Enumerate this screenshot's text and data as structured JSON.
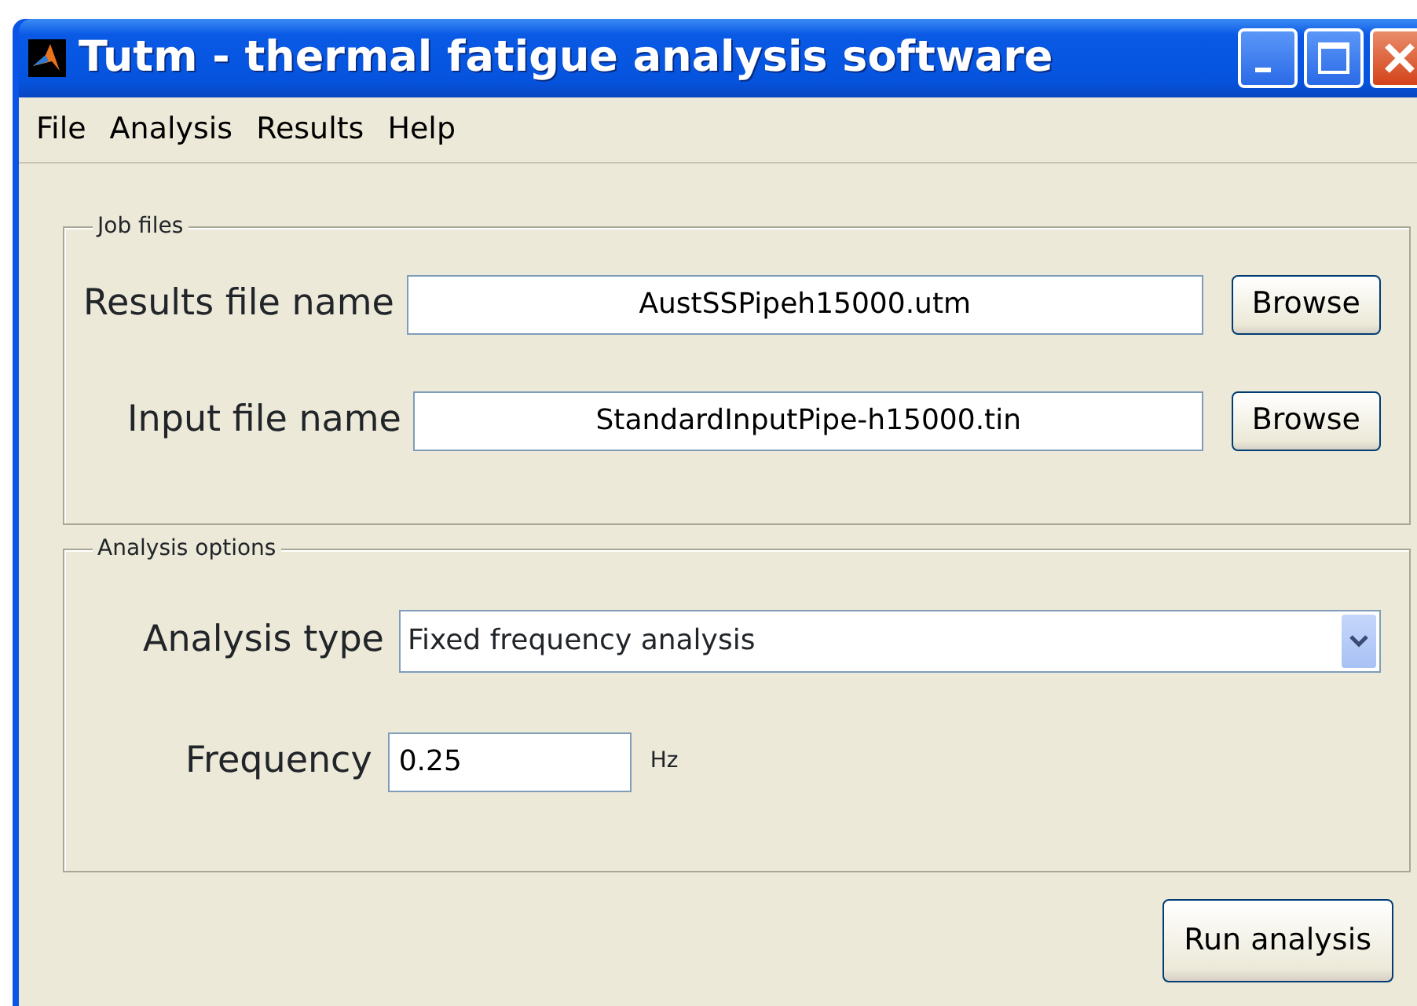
{
  "window": {
    "title": "Tutm - thermal fatigue analysis software"
  },
  "menu": [
    "File",
    "Analysis",
    "Results",
    "Help"
  ],
  "job_files": {
    "title": "Job files",
    "rows": [
      {
        "label": "Results file name",
        "value": "AustSSPipeh15000.utm",
        "button": "Browse"
      },
      {
        "label": "Input file name",
        "value": "StandardInputPipe-h15000.tin",
        "button": "Browse"
      }
    ]
  },
  "analysis_options": {
    "title": "Analysis options",
    "analysis_type": {
      "label": "Analysis type",
      "value": "Fixed frequency analysis"
    },
    "frequency": {
      "label": "Frequency",
      "value": "0.25",
      "unit": "Hz"
    }
  },
  "run_button": "Run analysis"
}
